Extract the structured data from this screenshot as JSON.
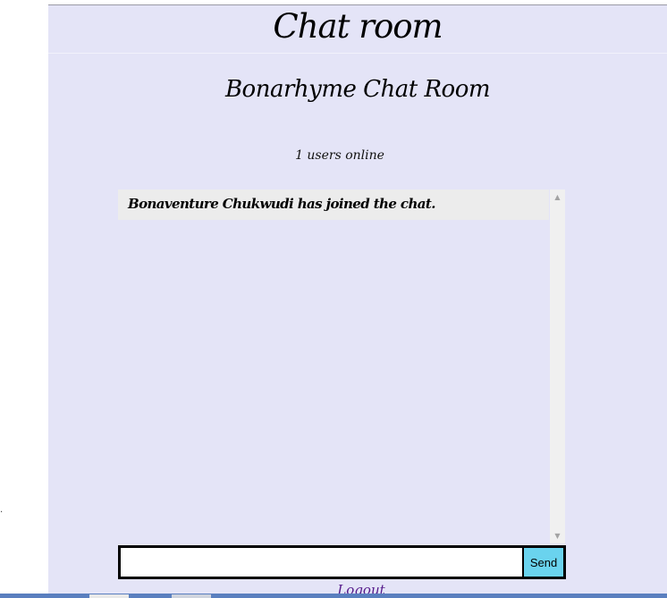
{
  "header": {
    "title": "Chat room"
  },
  "room": {
    "name": "Bonarhyme Chat Room",
    "online_text": "1 users online"
  },
  "messages": [
    {
      "text": "Bonaventure Chukwudi has joined the chat."
    }
  ],
  "composer": {
    "input_value": "",
    "send_label": "Send"
  },
  "footer": {
    "logout_label": "Logout"
  },
  "colors": {
    "background": "#e4e4f7",
    "message_bg": "#ececec",
    "send_button": "#6ad3ee",
    "link": "#551a8b"
  }
}
